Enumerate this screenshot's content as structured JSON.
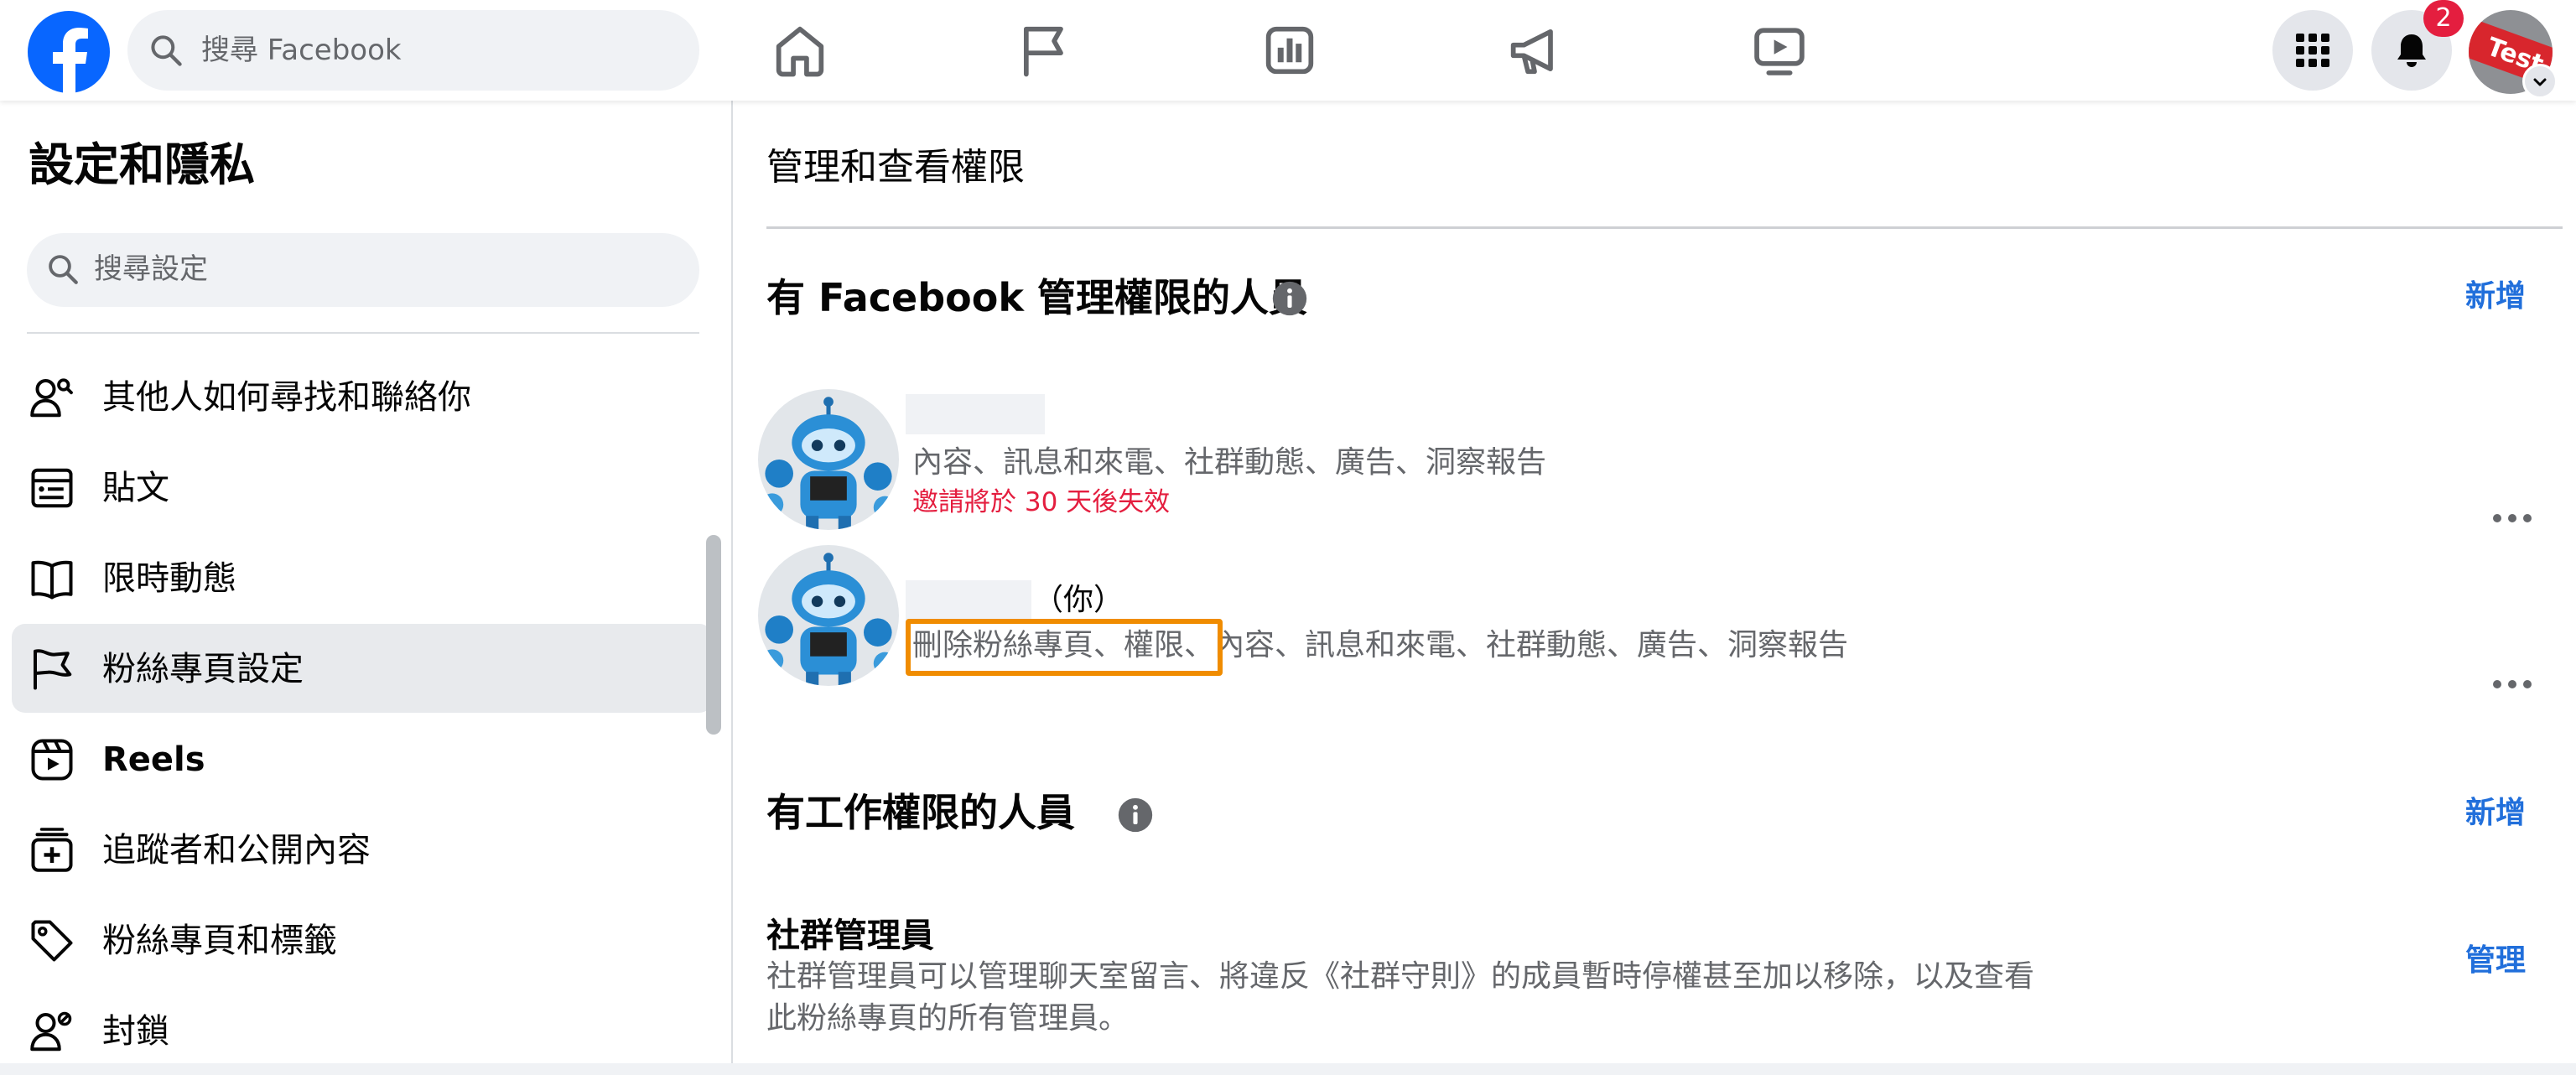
{
  "topbar": {
    "logo_icon": "facebook-logo",
    "search_placeholder": "搜尋 Facebook",
    "nav_icons": [
      "home-icon",
      "flag-icon",
      "insights-icon",
      "megaphone-icon",
      "video-icon"
    ],
    "right_icons": [
      "menu-grid-icon",
      "bell-icon"
    ],
    "notification_count": "2",
    "badge_color": "#e41e3f"
  },
  "sidebar": {
    "title": "設定和隱私",
    "search_placeholder": "搜尋設定",
    "items": [
      {
        "label": "其他人如何尋找和聯絡你",
        "icon": "people-search-icon"
      },
      {
        "label": "貼文",
        "icon": "post-icon"
      },
      {
        "label": "限時動態",
        "icon": "book-icon"
      },
      {
        "label": "粉絲專頁設定",
        "icon": "flag-icon"
      },
      {
        "label": "Reels",
        "icon": "reels-icon"
      },
      {
        "label": "追蹤者和公開內容",
        "icon": "add-follow-icon"
      },
      {
        "label": "粉絲專頁和標籤",
        "icon": "tag-icon"
      },
      {
        "label": "封鎖",
        "icon": "block-user-icon"
      }
    ]
  },
  "main": {
    "title": "管理和查看權限",
    "fb_access": {
      "title": "有 Facebook 管理權限的人員",
      "add_label": "新增",
      "people": [
        {
          "permissions": "內容、訊息和來電、社群動態、廣告、洞察報告",
          "note": "邀請將於 30 天後失效"
        },
        {
          "you_label": "（你）",
          "permissions_highlighted": "刪除粉絲專頁、權限",
          "permissions_rest": "、內容、訊息和來電、社群動態、廣告、洞察報告"
        }
      ]
    },
    "task_access": {
      "title": "有工作權限的人員",
      "add_label": "新增",
      "role": {
        "title": "社群管理員",
        "description": "社群管理員可以管理聊天室留言、將違反《社群守則》的成員暫時停權甚至加以移除，以及查看此粉絲專頁的所有管理員。",
        "manage_label": "管理"
      }
    },
    "accent_color": "#216fdb",
    "highlight_color": "#f08c00"
  }
}
